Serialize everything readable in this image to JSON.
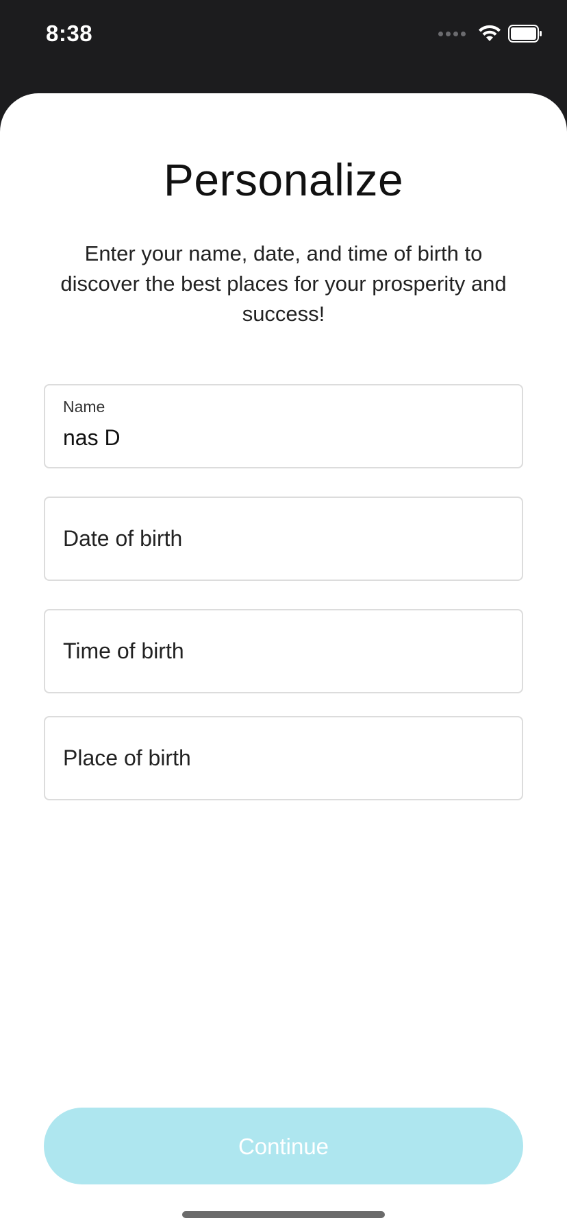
{
  "status_bar": {
    "time": "8:38",
    "icons": [
      "signal-icon",
      "wifi-icon",
      "battery-icon"
    ]
  },
  "page": {
    "title": "Personalize",
    "subtitle": "Enter your name, date, and time of birth to discover the best places for your prosperity and success!"
  },
  "form": {
    "name": {
      "label": "Name",
      "value": "nas D"
    },
    "date_of_birth": {
      "placeholder": "Date of birth"
    },
    "time_of_birth": {
      "placeholder": "Time of birth"
    },
    "place_of_birth": {
      "placeholder": "Place of birth"
    }
  },
  "actions": {
    "continue_label": "Continue"
  },
  "colors": {
    "status_bar_bg": "#1c1c1e",
    "continue_button_bg": "#aee6ef",
    "field_border": "#dcdcdc"
  }
}
